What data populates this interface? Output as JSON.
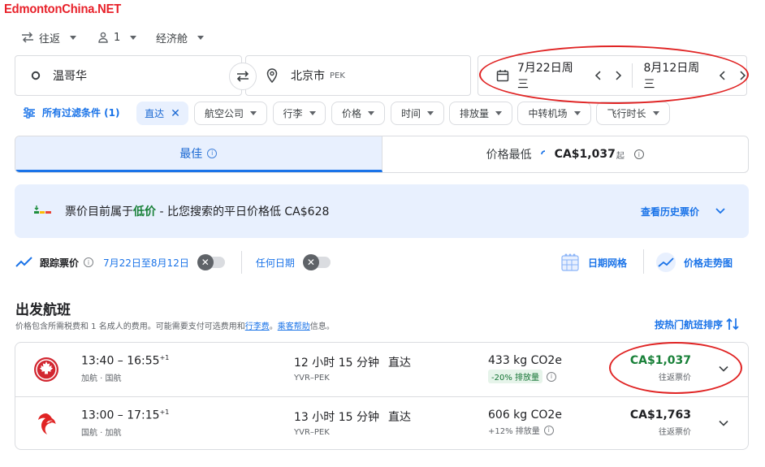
{
  "watermark": "EdmontonChina.NET",
  "trip_options": {
    "trip_type": "往返",
    "passengers": "1",
    "cabin": "经济舱"
  },
  "search": {
    "origin": "温哥华",
    "destination": "北京市",
    "destination_code": "PEK",
    "depart_date": "7月22日周三",
    "return_date": "8月12日周三"
  },
  "filters": {
    "all_filters": "所有过滤条件 (1)",
    "nonstop": "直达",
    "chips": [
      "航空公司",
      "行李",
      "价格",
      "时间",
      "排放量",
      "中转机场",
      "飞行时长"
    ]
  },
  "sort_tabs": {
    "best": "最佳",
    "cheapest": "价格最低",
    "cheapest_price": "CA$1,037",
    "cheapest_suffix": "起"
  },
  "insight": {
    "prefix": "票价目前属于",
    "level": "低价",
    "suffix": " - 比您搜索的平日价格低 CA$628",
    "history_link": "查看历史票价"
  },
  "tracking": {
    "track_label": "跟踪票价",
    "date_range": "7月22日至8月12日",
    "any_dates": "任何日期",
    "date_grid": "日期网格",
    "price_graph": "价格走势图"
  },
  "departing": {
    "title": "出发航班",
    "note_prefix": "价格包含所需税费和 1 名成人的费用。可能需要支付可选费用和",
    "note_link1": "行李费",
    "note_mid": "。",
    "note_link2": "乘客帮助",
    "note_suffix": "信息。",
    "sort_label": "按热门航班排序"
  },
  "flights": [
    {
      "times": "13:40 – 16:55",
      "plus": "+1",
      "airline": "加航 · 国航",
      "duration": "12 小时 15 分钟",
      "route": "YVR–PEK",
      "stops": "直达",
      "emissions": "433 kg CO2e",
      "emissions_note": "-20% 排放量",
      "price": "CA$1,037",
      "price_type": "往返票价"
    },
    {
      "times": "13:00 – 17:15",
      "plus": "+1",
      "airline": "国航 · 加航",
      "duration": "13 小时 15 分钟",
      "route": "YVR–PEK",
      "stops": "直达",
      "emissions": "606 kg CO2e",
      "emissions_note": "+12% 排放量",
      "price": "CA$1,763",
      "price_type": "往返票价"
    }
  ],
  "colors": {
    "accent": "#1a73e8",
    "low_price": "#188038",
    "annotation": "#e02424",
    "air_canada": "#d22630",
    "air_china": "#e02424"
  }
}
